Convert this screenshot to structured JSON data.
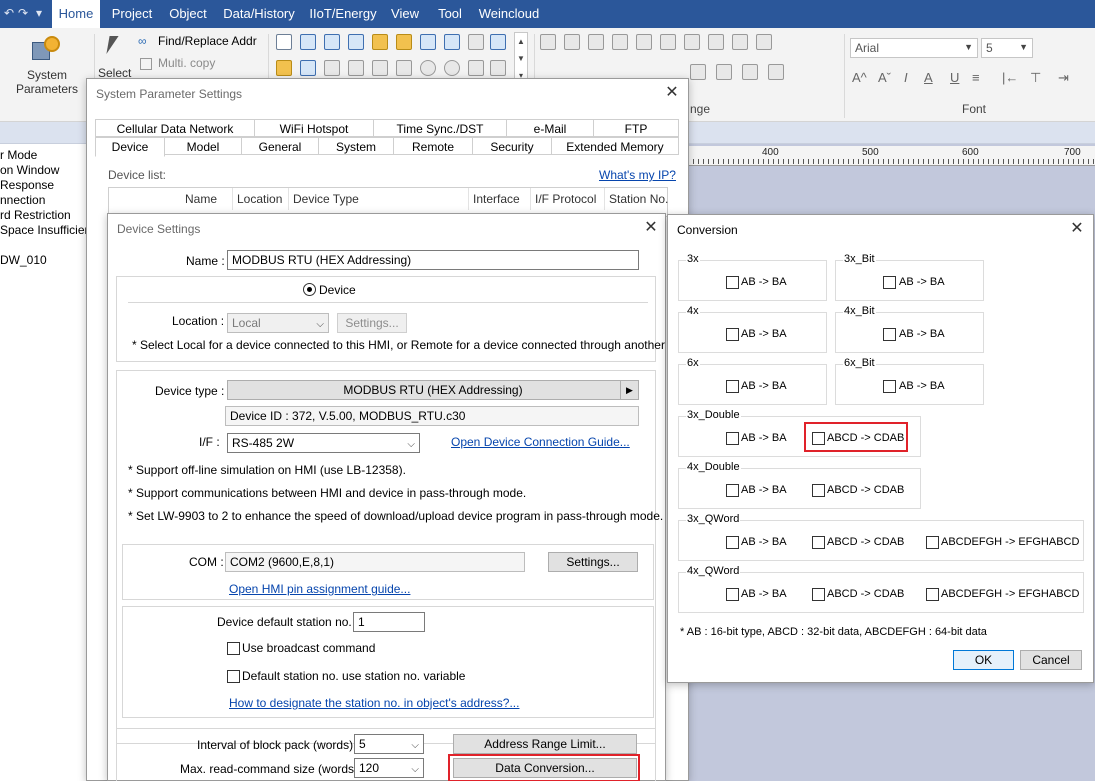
{
  "menubar": {
    "items": [
      "Home",
      "Project",
      "Object",
      "Data/History",
      "IIoT/Energy",
      "View",
      "Tool",
      "Weincloud"
    ],
    "active": "Home"
  },
  "ribbon": {
    "system_parameters_l1": "System",
    "system_parameters_l2": "Parameters",
    "select_label": "Select",
    "find_replace": "Find/Replace Addr",
    "multi_copy": "Multi. copy",
    "font_name": "Arial",
    "font_size": "5",
    "font_group": "Font",
    "range_group_partial": "nge"
  },
  "tree": {
    "items": [
      "r Mode",
      "on Window",
      "Response",
      "nnection",
      "rd Restriction",
      " Space Insufficier",
      "DW_010"
    ]
  },
  "ruler": {
    "marks": [
      "400",
      "500",
      "600",
      "700"
    ]
  },
  "system_params": {
    "title": "System Parameter Settings",
    "tabs_row1": [
      "Cellular Data Network",
      "WiFi Hotspot",
      "Time Sync./DST",
      "e-Mail",
      "FTP"
    ],
    "tabs_row2": [
      "Device",
      "Model",
      "General",
      "System",
      "Remote",
      "Security",
      "Extended Memory"
    ],
    "device_list_label": "Device list:",
    "whats_my_ip": "What's my IP?",
    "columns": [
      "Name",
      "Location",
      "Device Type",
      "Interface",
      "I/F Protocol",
      "Station No."
    ]
  },
  "device_settings": {
    "title": "Device Settings",
    "name_label": "Name :",
    "name_value": "MODBUS RTU (HEX Addressing)",
    "device_radio": "Device",
    "location_label": "Location :",
    "location_value": "Local",
    "location_settings_btn": "Settings...",
    "location_note": "* Select Local for a device connected to this HMI, or Remote for a device connected through another HMI.",
    "device_type_label": "Device type :",
    "device_type_value": "MODBUS RTU (HEX Addressing)",
    "device_id": "Device ID : 372, V.5.00, MODBUS_RTU.c30",
    "if_label": "I/F :",
    "if_value": "RS-485 2W",
    "open_guide_link": "Open Device Connection Guide...",
    "note1": "* Support off-line simulation on HMI (use LB-12358).",
    "note2": "* Support communications between HMI and device in pass-through mode.",
    "note3": "* Set LW-9903 to 2 to enhance the speed of download/upload device program in pass-through mode.",
    "com_label": "COM :",
    "com_value": "COM2 (9600,E,8,1)",
    "com_settings_btn": "Settings...",
    "pin_guide_link": "Open HMI pin assignment guide...",
    "station_label": "Device default station no. :",
    "station_value": "1",
    "broadcast_label": "Use broadcast command",
    "default_station_var_label": "Default station no. use station no. variable",
    "designate_link": "How to designate the station no. in object's address?...",
    "interval_label": "Interval of block pack (words) :",
    "interval_value": "5",
    "max_read_label": "Max. read-command size (words) :",
    "max_read_value": "120",
    "address_range_btn": "Address Range Limit...",
    "data_conversion_btn": "Data Conversion..."
  },
  "conversion": {
    "title": "Conversion",
    "groups": {
      "g3x": {
        "title": "3x",
        "opt1": "AB -> BA"
      },
      "g3x_bit": {
        "title": "3x_Bit",
        "opt1": "AB -> BA"
      },
      "g4x": {
        "title": "4x",
        "opt1": "AB -> BA"
      },
      "g4x_bit": {
        "title": "4x_Bit",
        "opt1": "AB -> BA"
      },
      "g6x": {
        "title": "6x",
        "opt1": "AB -> BA"
      },
      "g6x_bit": {
        "title": "6x_Bit",
        "opt1": "AB -> BA"
      },
      "g3x_double": {
        "title": "3x_Double",
        "opt1": "AB -> BA",
        "opt2": "ABCD -> CDAB"
      },
      "g4x_double": {
        "title": "4x_Double",
        "opt1": "AB -> BA",
        "opt2": "ABCD -> CDAB"
      },
      "g3x_qword": {
        "title": "3x_QWord",
        "opt1": "AB -> BA",
        "opt2": "ABCD -> CDAB",
        "opt3": "ABCDEFGH -> EFGHABCD"
      },
      "g4x_qword": {
        "title": "4x_QWord",
        "opt1": "AB -> BA",
        "opt2": "ABCD -> CDAB",
        "opt3": "ABCDEFGH -> EFGHABCD"
      }
    },
    "footnote": "* AB : 16-bit type, ABCD : 32-bit data, ABCDEFGH : 64-bit data",
    "ok_btn": "OK",
    "cancel_btn": "Cancel"
  },
  "colors": {
    "menubar": "#2b579a",
    "highlight": "#e0222a",
    "link": "#0645ad"
  }
}
